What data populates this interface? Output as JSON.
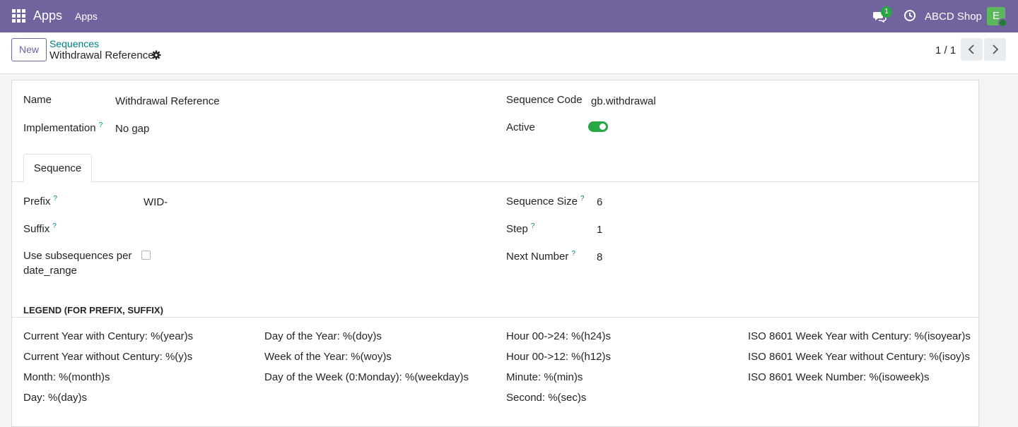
{
  "topbar": {
    "brand": "Apps",
    "menu_apps": "Apps",
    "chat_count": "1",
    "company": "ABCD Shop",
    "avatar_letter": "E"
  },
  "control": {
    "new_label": "New",
    "breadcrumb": "Sequences",
    "record_title": "Withdrawal Reference",
    "pager": "1 / 1"
  },
  "form": {
    "name_label": "Name",
    "name_value": "Withdrawal Reference",
    "impl_label": "Implementation",
    "impl_value": "No gap",
    "code_label": "Sequence Code",
    "code_value": "gb.withdrawal",
    "active_label": "Active",
    "active_value": true,
    "help_mark": "?",
    "tab_sequence": "Sequence",
    "prefix_label": "Prefix",
    "prefix_value": "WID-",
    "suffix_label": "Suffix",
    "suffix_value": "",
    "subseq_label_1": "Use subsequences per",
    "subseq_label_2": "date_range",
    "subseq_value": false,
    "size_label": "Sequence Size",
    "size_value": "6",
    "step_label": "Step",
    "step_value": "1",
    "next_label": "Next Number",
    "next_value": "8"
  },
  "legend": {
    "title": "LEGEND (FOR PREFIX, SUFFIX)",
    "col1": [
      "Current Year with Century: %(year)s",
      "Current Year without Century: %(y)s",
      "Month: %(month)s",
      "Day: %(day)s"
    ],
    "col2": [
      "Day of the Year: %(doy)s",
      "Week of the Year: %(woy)s",
      "Day of the Week (0:Monday): %(weekday)s"
    ],
    "col3": [
      "Hour 00->24: %(h24)s",
      "Hour 00->12: %(h12)s",
      "Minute: %(min)s",
      "Second: %(sec)s"
    ],
    "col4": [
      "ISO 8601 Week Year with Century: %(isoyear)s",
      "ISO 8601 Week Year without Century: %(isoy)s",
      "ISO 8601 Week Number: %(isoweek)s"
    ]
  },
  "colors": {
    "navbar": "#71639e",
    "accent": "#017e84",
    "toggle_on": "#28a745"
  }
}
